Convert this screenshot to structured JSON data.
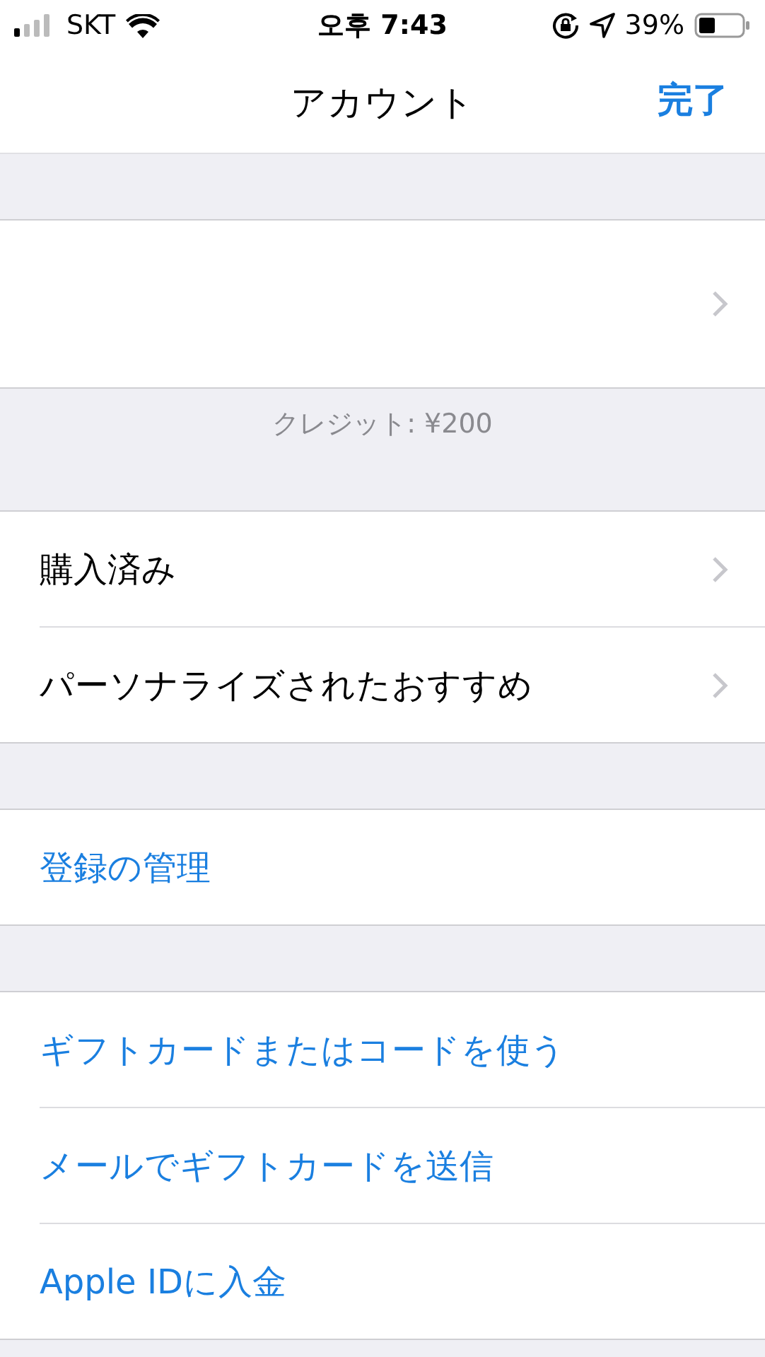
{
  "status_bar": {
    "carrier": "SKT",
    "time": "오후 7:43",
    "battery": "39%"
  },
  "nav": {
    "title": "アカウント",
    "done": "完了"
  },
  "sections": [
    {
      "rows": [
        {
          "kind": "nav"
        }
      ],
      "footer": "クレジット: ¥200"
    },
    {
      "rows": [
        {
          "kind": "nav",
          "label": "購入済み"
        },
        {
          "kind": "nav",
          "label": "パーソナライズされたおすすめ"
        }
      ]
    },
    {
      "rows": [
        {
          "kind": "link",
          "label": "登録の管理"
        }
      ]
    },
    {
      "rows": [
        {
          "kind": "link",
          "label": "ギフトカードまたはコードを使う"
        },
        {
          "kind": "link",
          "label": "メールでギフトカードを送信"
        },
        {
          "kind": "link",
          "label": "Apple IDに入金"
        }
      ]
    }
  ]
}
